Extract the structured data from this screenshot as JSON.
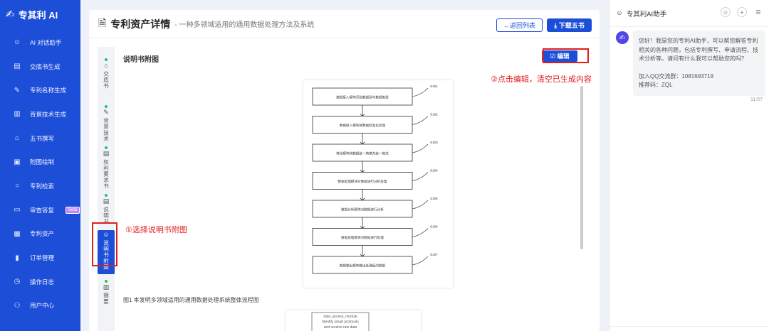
{
  "app": {
    "logo_text": "专其利 AI",
    "logo_mark": "✍"
  },
  "sidebar": {
    "items": [
      {
        "label": "AI 对话助手",
        "icon": "☺"
      },
      {
        "label": "交底书生成",
        "icon": "▤"
      },
      {
        "label": "专利名称生成",
        "icon": "✎"
      },
      {
        "label": "背景技术生成",
        "icon": "▥"
      },
      {
        "label": "五书撰写",
        "icon": "⌂"
      },
      {
        "label": "附图绘制",
        "icon": "▣"
      },
      {
        "label": "专利检索",
        "icon": "○"
      },
      {
        "label": "审查答复",
        "icon": "▭",
        "badge": "Beta"
      },
      {
        "label": "专利资产",
        "icon": "▦"
      },
      {
        "label": "订单管理",
        "icon": "▮"
      },
      {
        "label": "操作日志",
        "icon": "◷"
      },
      {
        "label": "用户中心",
        "icon": "⚇"
      }
    ]
  },
  "header": {
    "title": "专利资产详情",
    "subtitle": "- 一种多领域适用的通用数据处理方法及系统",
    "back_label": "←返回列表",
    "download_label": "⤓ 下载五书"
  },
  "tabs": [
    {
      "label": "交底书",
      "icon": "⌂"
    },
    {
      "label": "背景技术",
      "icon": "✎"
    },
    {
      "label": "权利要求书",
      "icon": "▤"
    },
    {
      "label": "说明书",
      "icon": "▤"
    },
    {
      "label": "说明书附图",
      "icon": "☺",
      "active": true
    },
    {
      "label": "摘要",
      "icon": "▥"
    }
  ],
  "content": {
    "section_title": "说明书附图",
    "edit_label": "☑ 编辑",
    "figure_caption": "图1 本发明多领域适用的通用数据处理系统整体流程图",
    "flow_steps": [
      {
        "code": "S101",
        "text": "数据接入模块识别数据源与数据类型"
      },
      {
        "code": "S102",
        "text": "数据接入模块将数据标准化处理"
      },
      {
        "code": "S103",
        "text": "转化模块将数据统一转换为统一格式"
      },
      {
        "code": "S104",
        "text": "数据处理模块对数据进行分析处理"
      },
      {
        "code": "S105",
        "text": "数据分析模块对数据进行分析"
      },
      {
        "code": "S106",
        "text": "数据处理模块对数据进行处理"
      },
      {
        "code": "S107",
        "text": "数据输出模块输出处理后的数据"
      }
    ],
    "figure2_lines": [
      "data_access_module",
      "Identify smart protocols",
      "and receive raw data"
    ]
  },
  "annotations": {
    "edit_note": "②点击编辑，清空已生成内容",
    "tab_note": "①选择说明书附图"
  },
  "assistant": {
    "title": "专其利AI助手",
    "message_p1": "您好！我是您的专利AI助手，可以帮您解答专利相关的各种问题，包括专利撰写、申请流程、技术分析等。请问有什么我可以帮助您的吗？",
    "qq_line": "加入QQ交流群：1081693719",
    "ref_line": "推荐码：ZQL",
    "time": "11:57"
  },
  "colors": {
    "primary": "#1d4ed8",
    "annotation": "#e11d1d",
    "status_dot": "#22c55e"
  }
}
